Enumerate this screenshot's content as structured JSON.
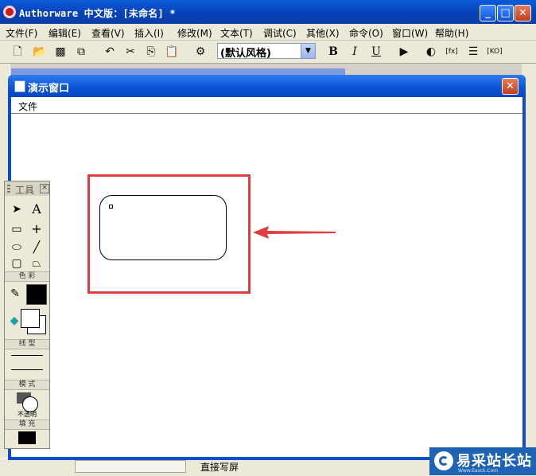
{
  "main_window": {
    "title": "Authorware 中文版：[未命名] *"
  },
  "menubar": {
    "items": [
      "文件(F)",
      "编辑(E)",
      "查看(V)",
      "插入(I)",
      "修改(M)",
      "文本(T)",
      "调试(C)",
      "其他(X)",
      "命令(O)",
      "窗口(W)",
      "帮助(H)"
    ]
  },
  "toolbar": {
    "style_select_value": "(默认风格)",
    "bold_label": "B",
    "italic_label": "I",
    "underline_label": "U"
  },
  "presentation_window": {
    "title": "演示窗口",
    "menu_file": "文件"
  },
  "tools_palette": {
    "title": "工具",
    "color_label": "色 彩",
    "line_label": "线 型",
    "mode_label": "模 式",
    "mode_value": "不透明",
    "fill_label": "填 充"
  },
  "background": {
    "bottom_text": "直接写屏"
  },
  "annotation": {
    "highlight_color": "#de3e3e"
  },
  "watermark": {
    "text": "易采站长站",
    "subtext": "Www.Easck.Com"
  },
  "colors": {
    "titlebar": "#0a52d4",
    "chrome": "#ece9d8",
    "annotation": "#de3e3e"
  }
}
